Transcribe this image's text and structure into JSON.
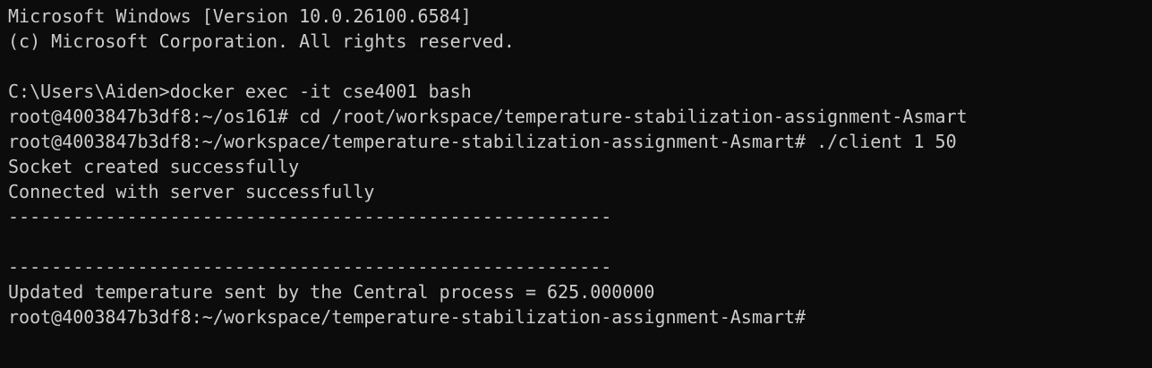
{
  "colors": {
    "background": "#0c0c0c",
    "foreground": "#cccccc"
  },
  "terminal": {
    "lines": [
      "Microsoft Windows [Version 10.0.26100.6584]",
      "(c) Microsoft Corporation. All rights reserved.",
      "",
      "C:\\Users\\Aiden>docker exec -it cse4001 bash",
      "root@4003847b3df8:~/os161# cd /root/workspace/temperature-stabilization-assignment-Asmart",
      "root@4003847b3df8:~/workspace/temperature-stabilization-assignment-Asmart# ./client 1 50",
      "Socket created successfully",
      "Connected with server successfully",
      "--------------------------------------------------------",
      "",
      "--------------------------------------------------------",
      "Updated temperature sent by the Central process = 625.000000",
      "root@4003847b3df8:~/workspace/temperature-stabilization-assignment-Asmart#"
    ]
  }
}
